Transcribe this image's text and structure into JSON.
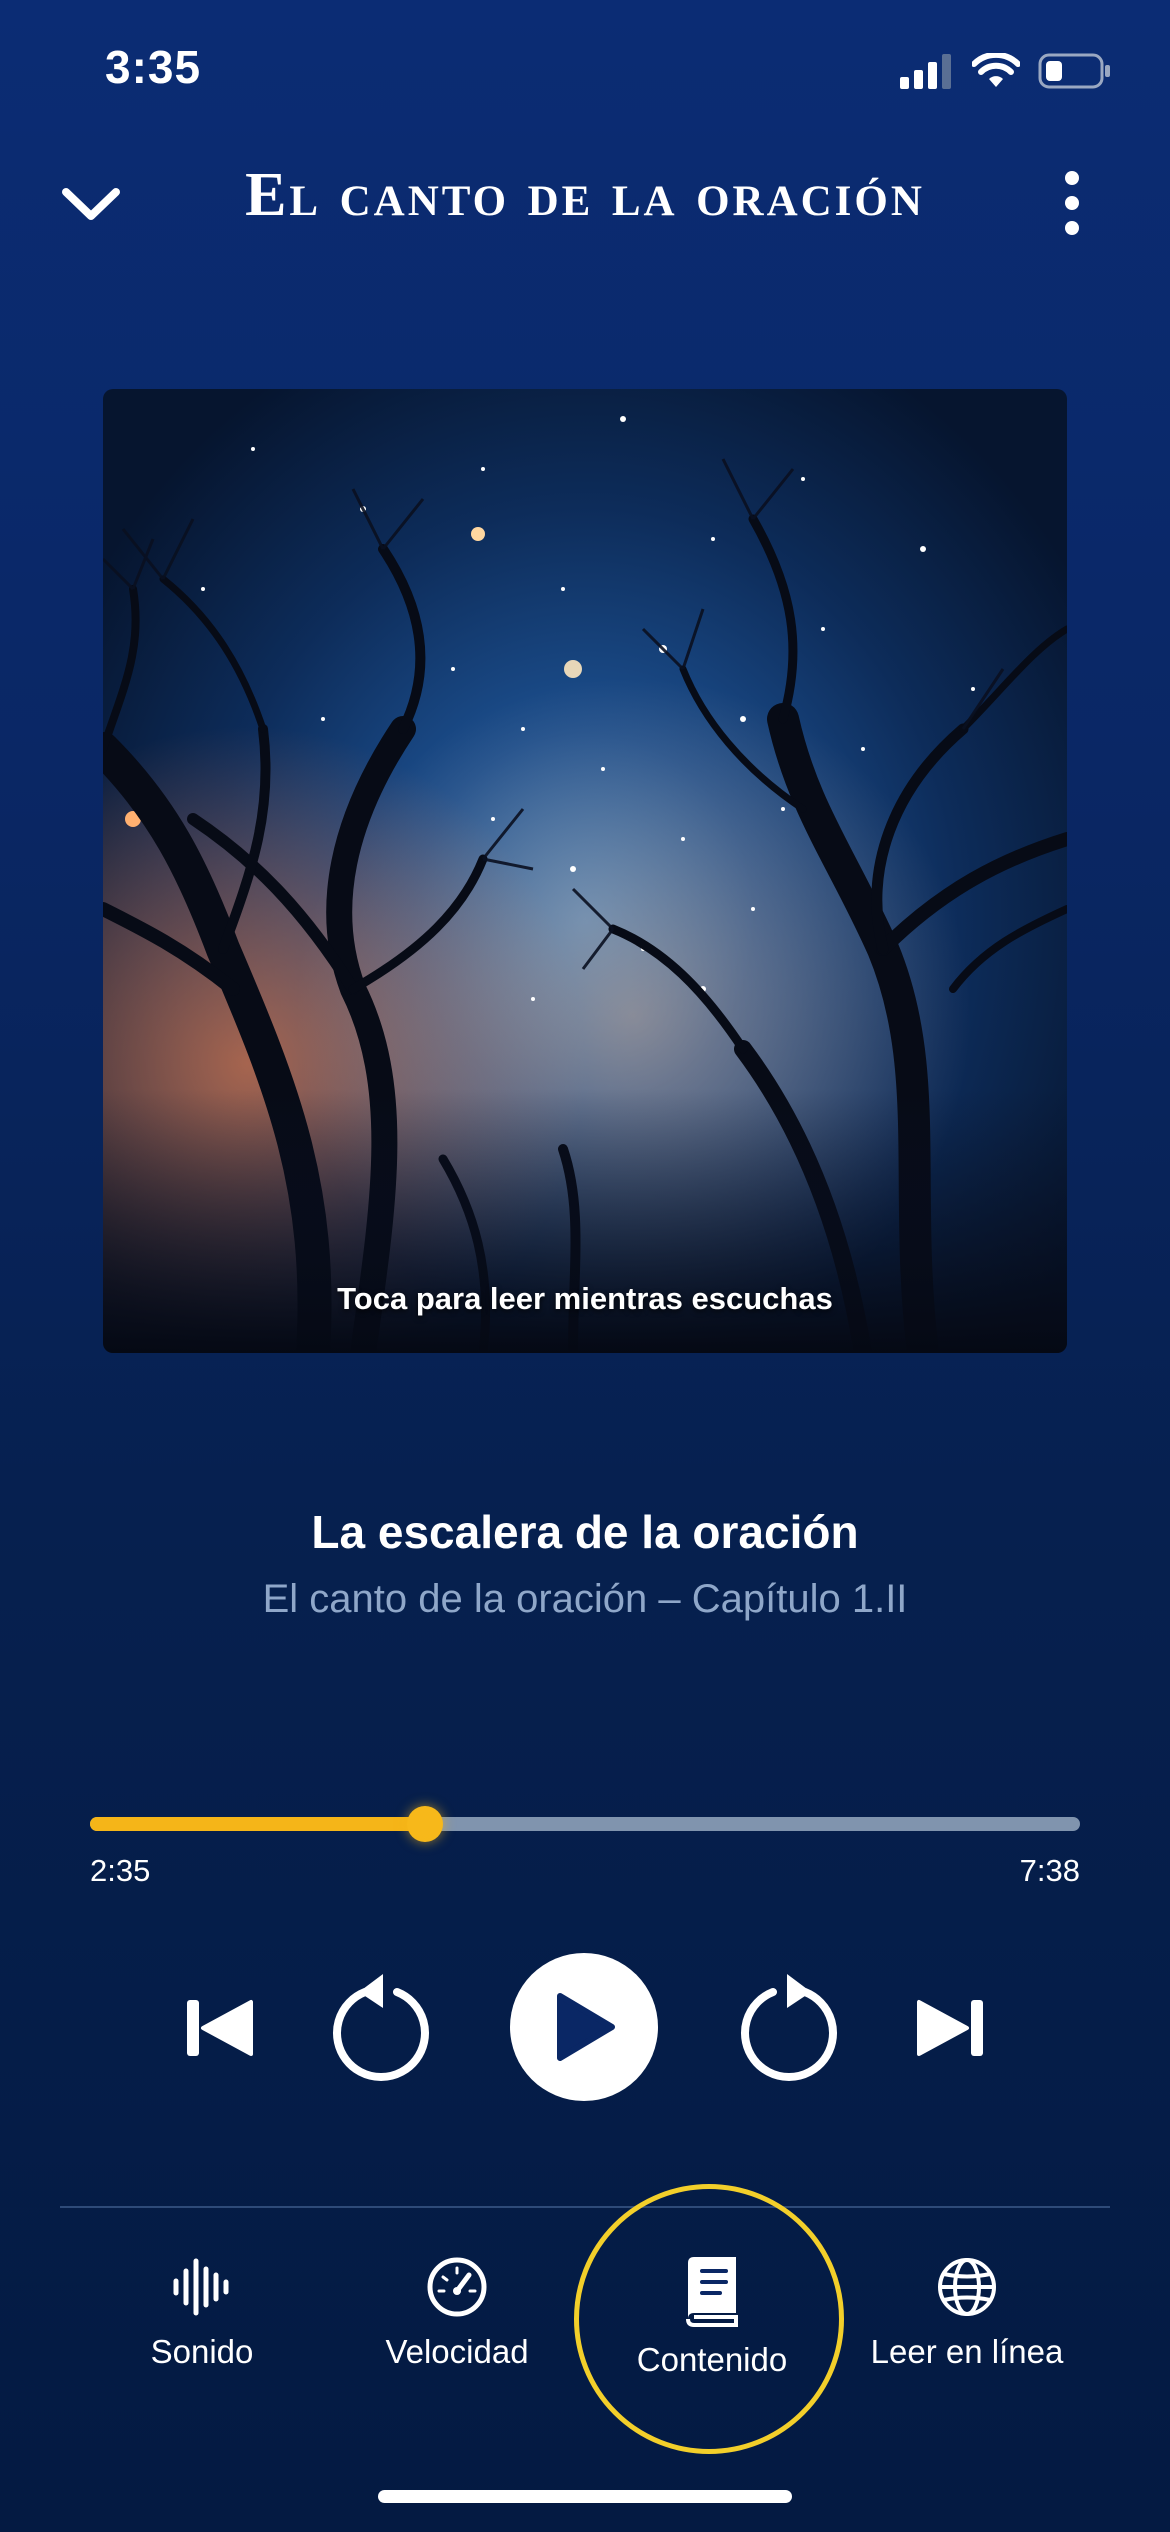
{
  "status_bar": {
    "time": "3:35"
  },
  "header": {
    "title": "El canto de la oración"
  },
  "artwork": {
    "caption": "Toca para leer mientras escuchas"
  },
  "track": {
    "title": "La escalera de la oración",
    "subtitle": "El canto de la oración – Capítulo 1.II"
  },
  "progress": {
    "current": "2:35",
    "duration": "7:38",
    "fraction": 0.338
  },
  "tabs": [
    {
      "label": "Sonido",
      "icon": "waveform-icon"
    },
    {
      "label": "Velocidad",
      "icon": "speedometer-icon"
    },
    {
      "label": "Contenido",
      "icon": "book-icon"
    },
    {
      "label": "Leer en línea",
      "icon": "globe-icon"
    }
  ],
  "colors": {
    "accent": "#f5b518",
    "highlight_ring": "#f3cf2a",
    "background": "#0a2765"
  }
}
